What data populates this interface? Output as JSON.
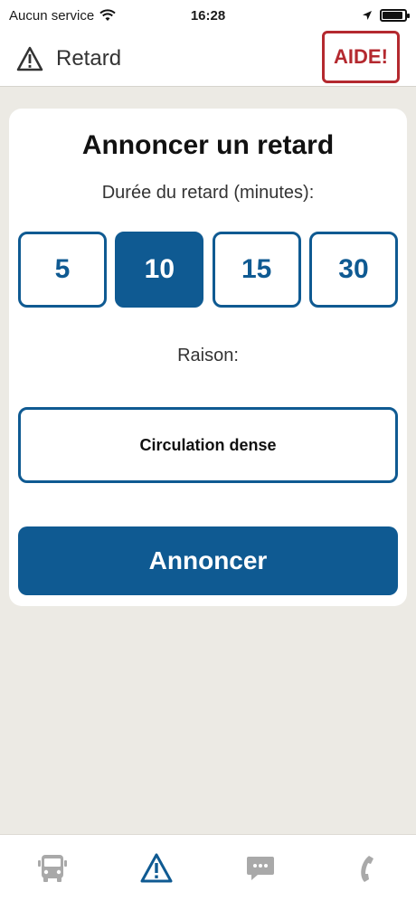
{
  "status_bar": {
    "carrier": "Aucun service",
    "time": "16:28"
  },
  "header": {
    "title": "Retard",
    "help_label": "AIDE!"
  },
  "card": {
    "title": "Annoncer un retard",
    "duration_label": "Durée du retard (minutes):",
    "durations": [
      "5",
      "10",
      "15",
      "30"
    ],
    "selected_duration": "10",
    "reason_label": "Raison:",
    "reason_value": "Circulation dense",
    "submit_label": "Annoncer"
  },
  "colors": {
    "primary": "#0f5a92",
    "help_red": "#b4292f",
    "background": "#eceae4",
    "tab_inactive": "#a9a9a9"
  },
  "tabs": [
    {
      "icon": "bus-icon",
      "active": false
    },
    {
      "icon": "warning-icon",
      "active": true
    },
    {
      "icon": "chat-icon",
      "active": false
    },
    {
      "icon": "phone-icon",
      "active": false
    }
  ]
}
